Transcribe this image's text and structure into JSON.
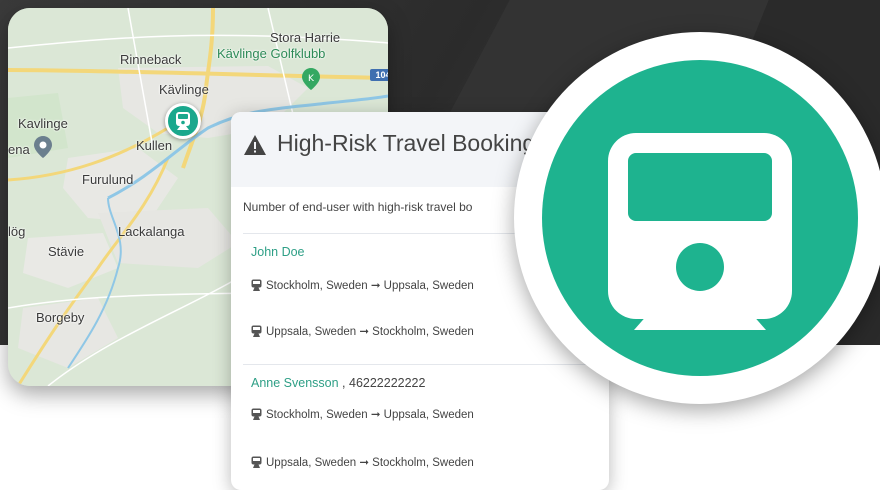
{
  "colors": {
    "accent": "#1eb38f",
    "link": "#2e9f86",
    "dark_background": "#2f2f2f"
  },
  "map": {
    "labels": {
      "rinneback": "Rinneback",
      "stora_harrie": "Stora Harrie",
      "golfklubb": "Kävlinge Golfklubb",
      "kavlinge_town": "Kävlinge",
      "kavlinge_west": "Kavlinge",
      "ena": "ena",
      "kullen": "Kullen",
      "furulund": "Furulund",
      "log": "lög",
      "lackalanga": "Lackalanga",
      "stavie": "Stävie",
      "borgeby": "Borgeby"
    },
    "road_number": "104",
    "pin_icon": "train-icon",
    "poi_icon": "place-pin-icon",
    "golf_icon": "golf-pin-icon"
  },
  "booking": {
    "header_icon": "warning-triangle-icon",
    "title": "High-Risk Travel Booking",
    "subtitle": "Number of end-user with high-risk travel bo",
    "trip_icon": "train-icon",
    "users": [
      {
        "name": "John Doe",
        "phone": "",
        "trips": [
          "Stockholm, Sweden ➞ Uppsala, Sweden",
          "Uppsala, Sweden ➞ Stockholm, Sweden"
        ]
      },
      {
        "name": "Anne Svensson",
        "phone": ", 46222222222",
        "trips": [
          "Stockholm, Sweden ➞ Uppsala, Sweden",
          "Uppsala, Sweden ➞ Stockholm, Sweden"
        ]
      }
    ]
  },
  "badge": {
    "icon": "train-icon"
  }
}
